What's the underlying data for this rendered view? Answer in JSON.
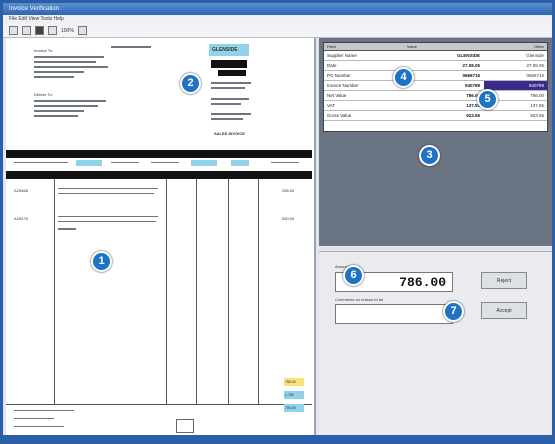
{
  "window": {
    "title": "Invoice Verification"
  },
  "menu": {
    "items": "File  Edit  View  Tools  Help"
  },
  "toolbar": {
    "zoom_text": "100%"
  },
  "invoice": {
    "logo_text": "GLENSIDE",
    "bill_to": "Invoice To:",
    "ship_to": "Deliver To:",
    "invoice_label": "SALES INVOICE",
    "table_headers": [
      "Code",
      "Description",
      "Qty",
      "Price",
      "Disc",
      "Net",
      "Total"
    ],
    "lines": [
      {
        "code": "A25468",
        "desc": "Description of goods supplied to the customer",
        "amount": "256.00"
      },
      {
        "code": "A25475",
        "desc": "Description of goods supplied to the customer",
        "amount": "530.00"
      }
    ],
    "totals": [
      "786.00",
      "1,786",
      "786.00"
    ]
  },
  "detail_table": {
    "headers": [
      "Field",
      "Value",
      "Other"
    ],
    "rows": [
      {
        "label": "Supplier Name",
        "value": "GLENSIDE",
        "other": "Glenside"
      },
      {
        "label": "Date",
        "value": "27.08.05",
        "other": "27.08.05",
        "selected": false
      },
      {
        "label": "PO Number",
        "value": "0666716",
        "other": "0666716",
        "selected": false
      },
      {
        "label": "Invoice Number",
        "value": "940789",
        "other": "940789",
        "selected": true
      },
      {
        "label": "Net Value",
        "value": "786.00",
        "other": "786.00",
        "selected": false
      },
      {
        "label": "VAT",
        "value": "137.55",
        "other": "137.55",
        "selected": false
      },
      {
        "label": "Gross Value",
        "value": "923.55",
        "other": "923.55",
        "selected": false
      }
    ]
  },
  "verify": {
    "amount_label": "Amount Value",
    "amount_value": "786.00",
    "reason_label": "Comments on reason to be",
    "reject_label": "Reject",
    "accept_label": "Accept"
  },
  "callouts": [
    "1",
    "2",
    "3",
    "4",
    "5",
    "6",
    "7"
  ],
  "colors": {
    "accent": "#1f73c4",
    "highlight": "#8fd3ea",
    "selected": "#3a2a8c"
  }
}
